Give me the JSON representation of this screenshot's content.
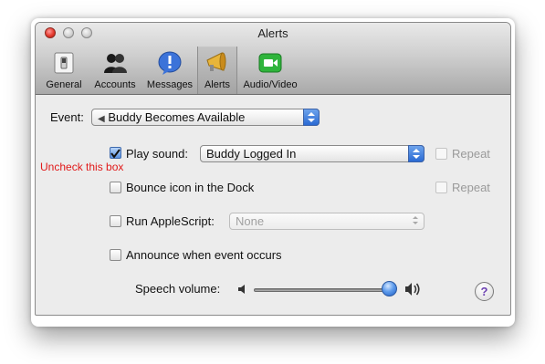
{
  "window": {
    "title": "Alerts"
  },
  "toolbar": {
    "items": [
      {
        "label": "General",
        "icon": "switch-icon"
      },
      {
        "label": "Accounts",
        "icon": "people-icon"
      },
      {
        "label": "Messages",
        "icon": "speech-bubble-icon"
      },
      {
        "label": "Alerts",
        "icon": "megaphone-icon",
        "selected": true
      },
      {
        "label": "Audio/Video",
        "icon": "video-camera-icon"
      }
    ]
  },
  "event": {
    "label": "Event:",
    "value": "Buddy Becomes Available"
  },
  "play_sound": {
    "label": "Play sound:",
    "checked": true,
    "value": "Buddy Logged In",
    "repeat_label": "Repeat",
    "repeat_checked": false
  },
  "annotation": "Uncheck this box",
  "bounce": {
    "label": "Bounce icon in the Dock",
    "checked": false,
    "repeat_label": "Repeat",
    "repeat_checked": false
  },
  "applescript": {
    "label": "Run AppleScript:",
    "checked": false,
    "value": "None"
  },
  "announce": {
    "label": "Announce when event occurs",
    "checked": false
  },
  "speech_volume": {
    "label": "Speech volume:",
    "level": 1.0
  },
  "help": {
    "symbol": "?"
  },
  "colors": {
    "annotation": "#e11919",
    "accent": "#2a6ad3"
  }
}
